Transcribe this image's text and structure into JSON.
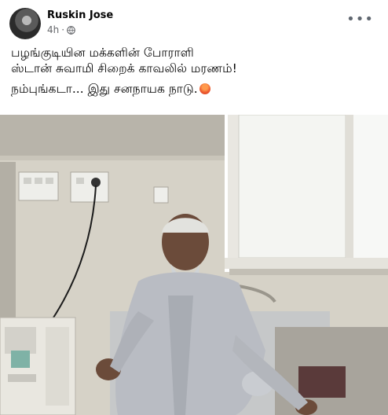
{
  "post": {
    "author": "Ruskin Jose",
    "time": "4h",
    "privacy_icon": "globe-icon",
    "more_icon": "more-options-icon",
    "text_line1": "பழங்குடியின மக்களின் போராளி",
    "text_line2": "ஸ்டான் சுவாமி சிறைக் காவலில் மரணம்!",
    "text_line3": "நம்புங்கடா... இது சனநாயக நாடு.",
    "emoji": "angry-face-emoji"
  },
  "colors": {
    "primary_text": "#050505",
    "secondary_text": "#65676b",
    "wall": "#d7d3c8"
  }
}
